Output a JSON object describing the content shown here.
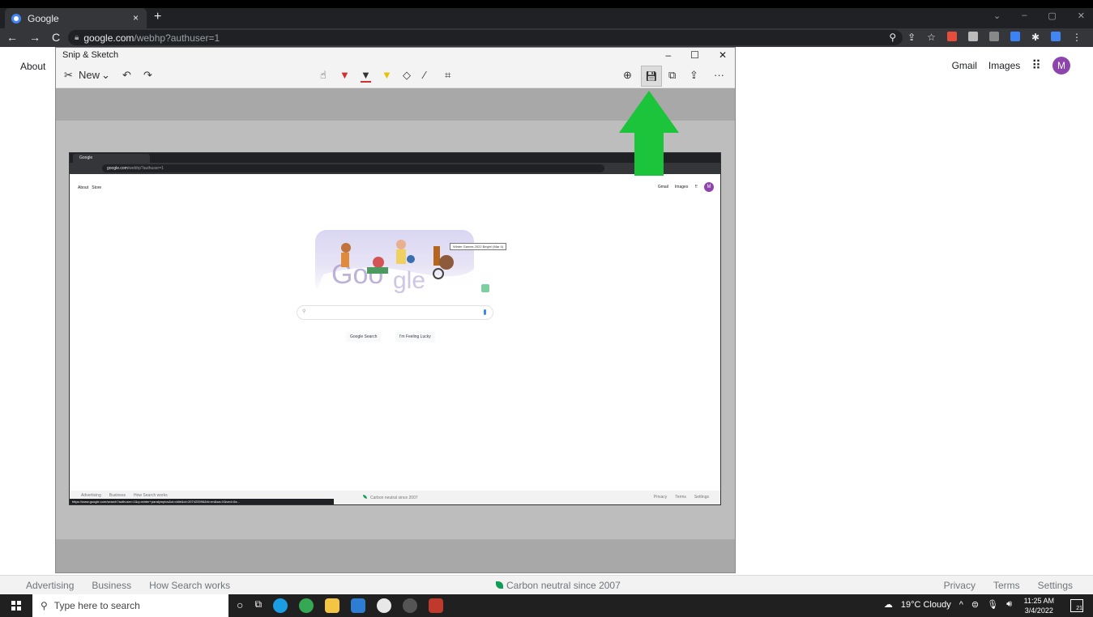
{
  "browser": {
    "tab_title": "Google",
    "tab_close": "×",
    "new_tab": "+",
    "url_domain": "google.com",
    "url_path": "/webhp?authuser=1",
    "window_controls": [
      "⌄",
      "–",
      "▢",
      "✕"
    ]
  },
  "google": {
    "about": "About",
    "gmail": "Gmail",
    "images": "Images",
    "avatar_letter": "M",
    "footer_left": [
      "Advertising",
      "Business",
      "How Search works"
    ],
    "footer_center": "Carbon neutral since 2007",
    "footer_right": [
      "Privacy",
      "Terms",
      "Settings"
    ]
  },
  "snip": {
    "title": "Snip & Sketch",
    "new_label": "New",
    "minimize": "–",
    "maximize": "☐",
    "close": "✕",
    "more": "···"
  },
  "inner": {
    "tab_title": "Google",
    "url_domain": "google.com",
    "url_path": "/webhp?authuser=1",
    "about": "About",
    "store": "Store",
    "gmail": "Gmail",
    "images": "Images",
    "avatar_letter": "M",
    "doodle_tooltip": "Winter Games 2022 Begin! (Mar 4)",
    "google_search": "Google Search",
    "feeling_lucky": "I'm Feeling Lucky",
    "footer_left": [
      "Advertising",
      "Business",
      "How Search works"
    ],
    "footer_center": "Carbon neutral since 2007",
    "footer_right": [
      "Privacy",
      "Terms",
      "Settings"
    ],
    "status_url": "https://www.google.com/search?authuser=1&q=winter+paralympics&oi=ddle&ct=207425396&hl=en&sa=X&ved=0a..."
  },
  "taskbar": {
    "search_placeholder": "Type here to search",
    "weather": "19°C  Cloudy",
    "time": "11:25 AM",
    "date": "3/4/2022",
    "notifications": "21"
  },
  "colors": {
    "arrow": "#1bc43a",
    "chrome_dark": "#202124",
    "avatar": "#8e44ad"
  }
}
